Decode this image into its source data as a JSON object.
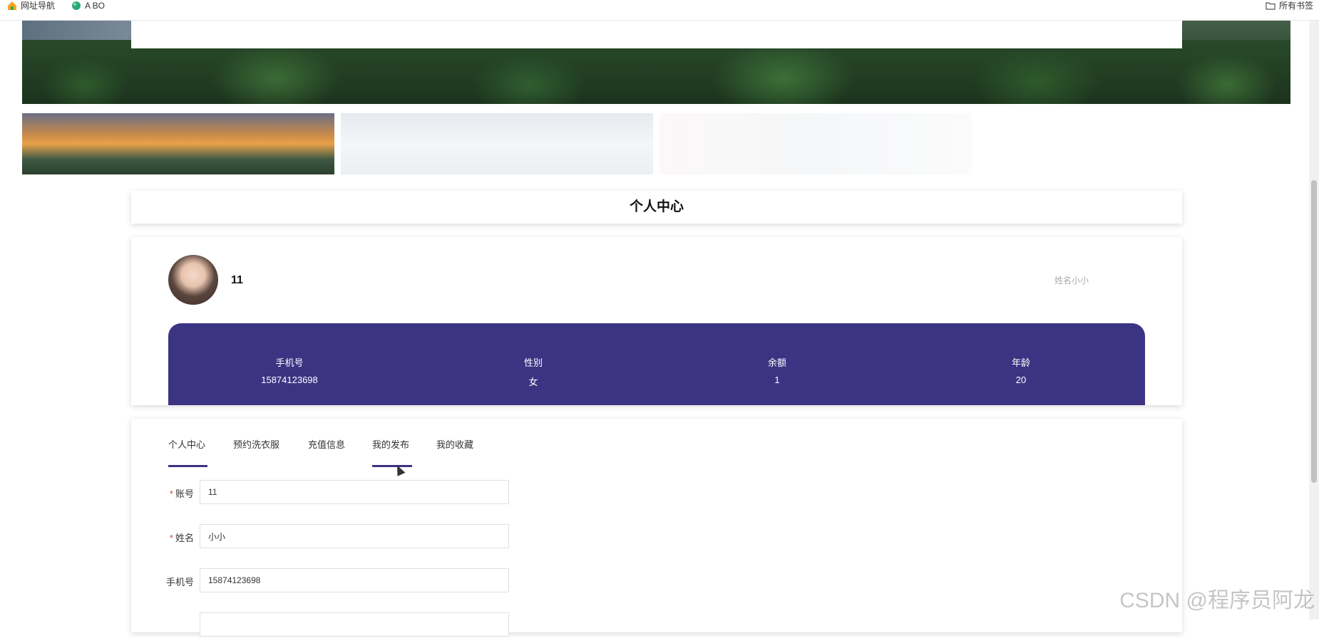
{
  "bookmarks": [
    {
      "label": "网址导航",
      "icon": "home-icon"
    },
    {
      "label": "A BO",
      "icon": "globe-icon"
    }
  ],
  "bookmarks_right": {
    "label": "所有书签",
    "icon": "folder-icon"
  },
  "page_title": "个人中心",
  "profile": {
    "username": "11",
    "name_label": "姓名小小",
    "stats": [
      {
        "label": "手机号",
        "value": "15874123698"
      },
      {
        "label": "性别",
        "value": "女"
      },
      {
        "label": "余额",
        "value": "1"
      },
      {
        "label": "年龄",
        "value": "20"
      }
    ]
  },
  "tabs": [
    {
      "label": "个人中心"
    },
    {
      "label": "预约洗衣服"
    },
    {
      "label": "充值信息"
    },
    {
      "label": "我的发布"
    },
    {
      "label": "我的收藏"
    }
  ],
  "form": {
    "account": {
      "label": "账号",
      "value": "11",
      "required_mark": "*"
    },
    "name": {
      "label": "姓名",
      "value": "小小",
      "required_mark": "*"
    },
    "phone": {
      "label": "手机号",
      "value": "15874123698"
    }
  },
  "watermark": "CSDN @程序员阿龙",
  "colors": {
    "accent": "#3d3383"
  }
}
